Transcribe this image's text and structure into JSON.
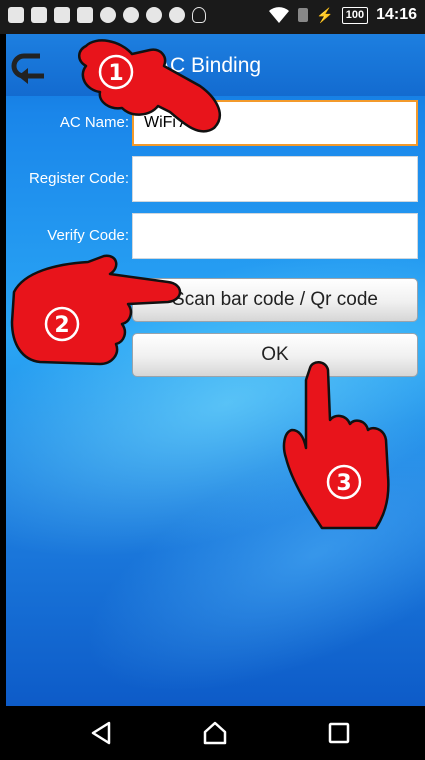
{
  "status_bar": {
    "time": "14:16",
    "battery": "100",
    "icons": [
      "chat-icon",
      "gallery-icon",
      "image-icon",
      "mail-icon",
      "cat-icon",
      "search-xl-icon",
      "circle-icon",
      "record-icon",
      "lightbulb-icon",
      "wifi-icon",
      "sim-icon",
      "charging-icon"
    ]
  },
  "titlebar": {
    "title": "AC Binding"
  },
  "form": {
    "ac_name_label": "AC Name:",
    "ac_name_value": "WiFi AC",
    "register_code_label": "Register Code:",
    "register_code_value": "",
    "verify_code_label": "Verify Code:",
    "verify_code_value": ""
  },
  "buttons": {
    "scan": "Scan bar code / Qr code",
    "ok": "OK"
  },
  "annotations": {
    "step1": "①",
    "step2": "②",
    "step3": "③"
  },
  "colors": {
    "titlebar": "#136bd0",
    "focus_border": "#f39a2b",
    "hand_red": "#e8141b"
  },
  "navbar": {
    "icons": [
      "back-triangle-icon",
      "home-icon",
      "recents-icon"
    ]
  }
}
